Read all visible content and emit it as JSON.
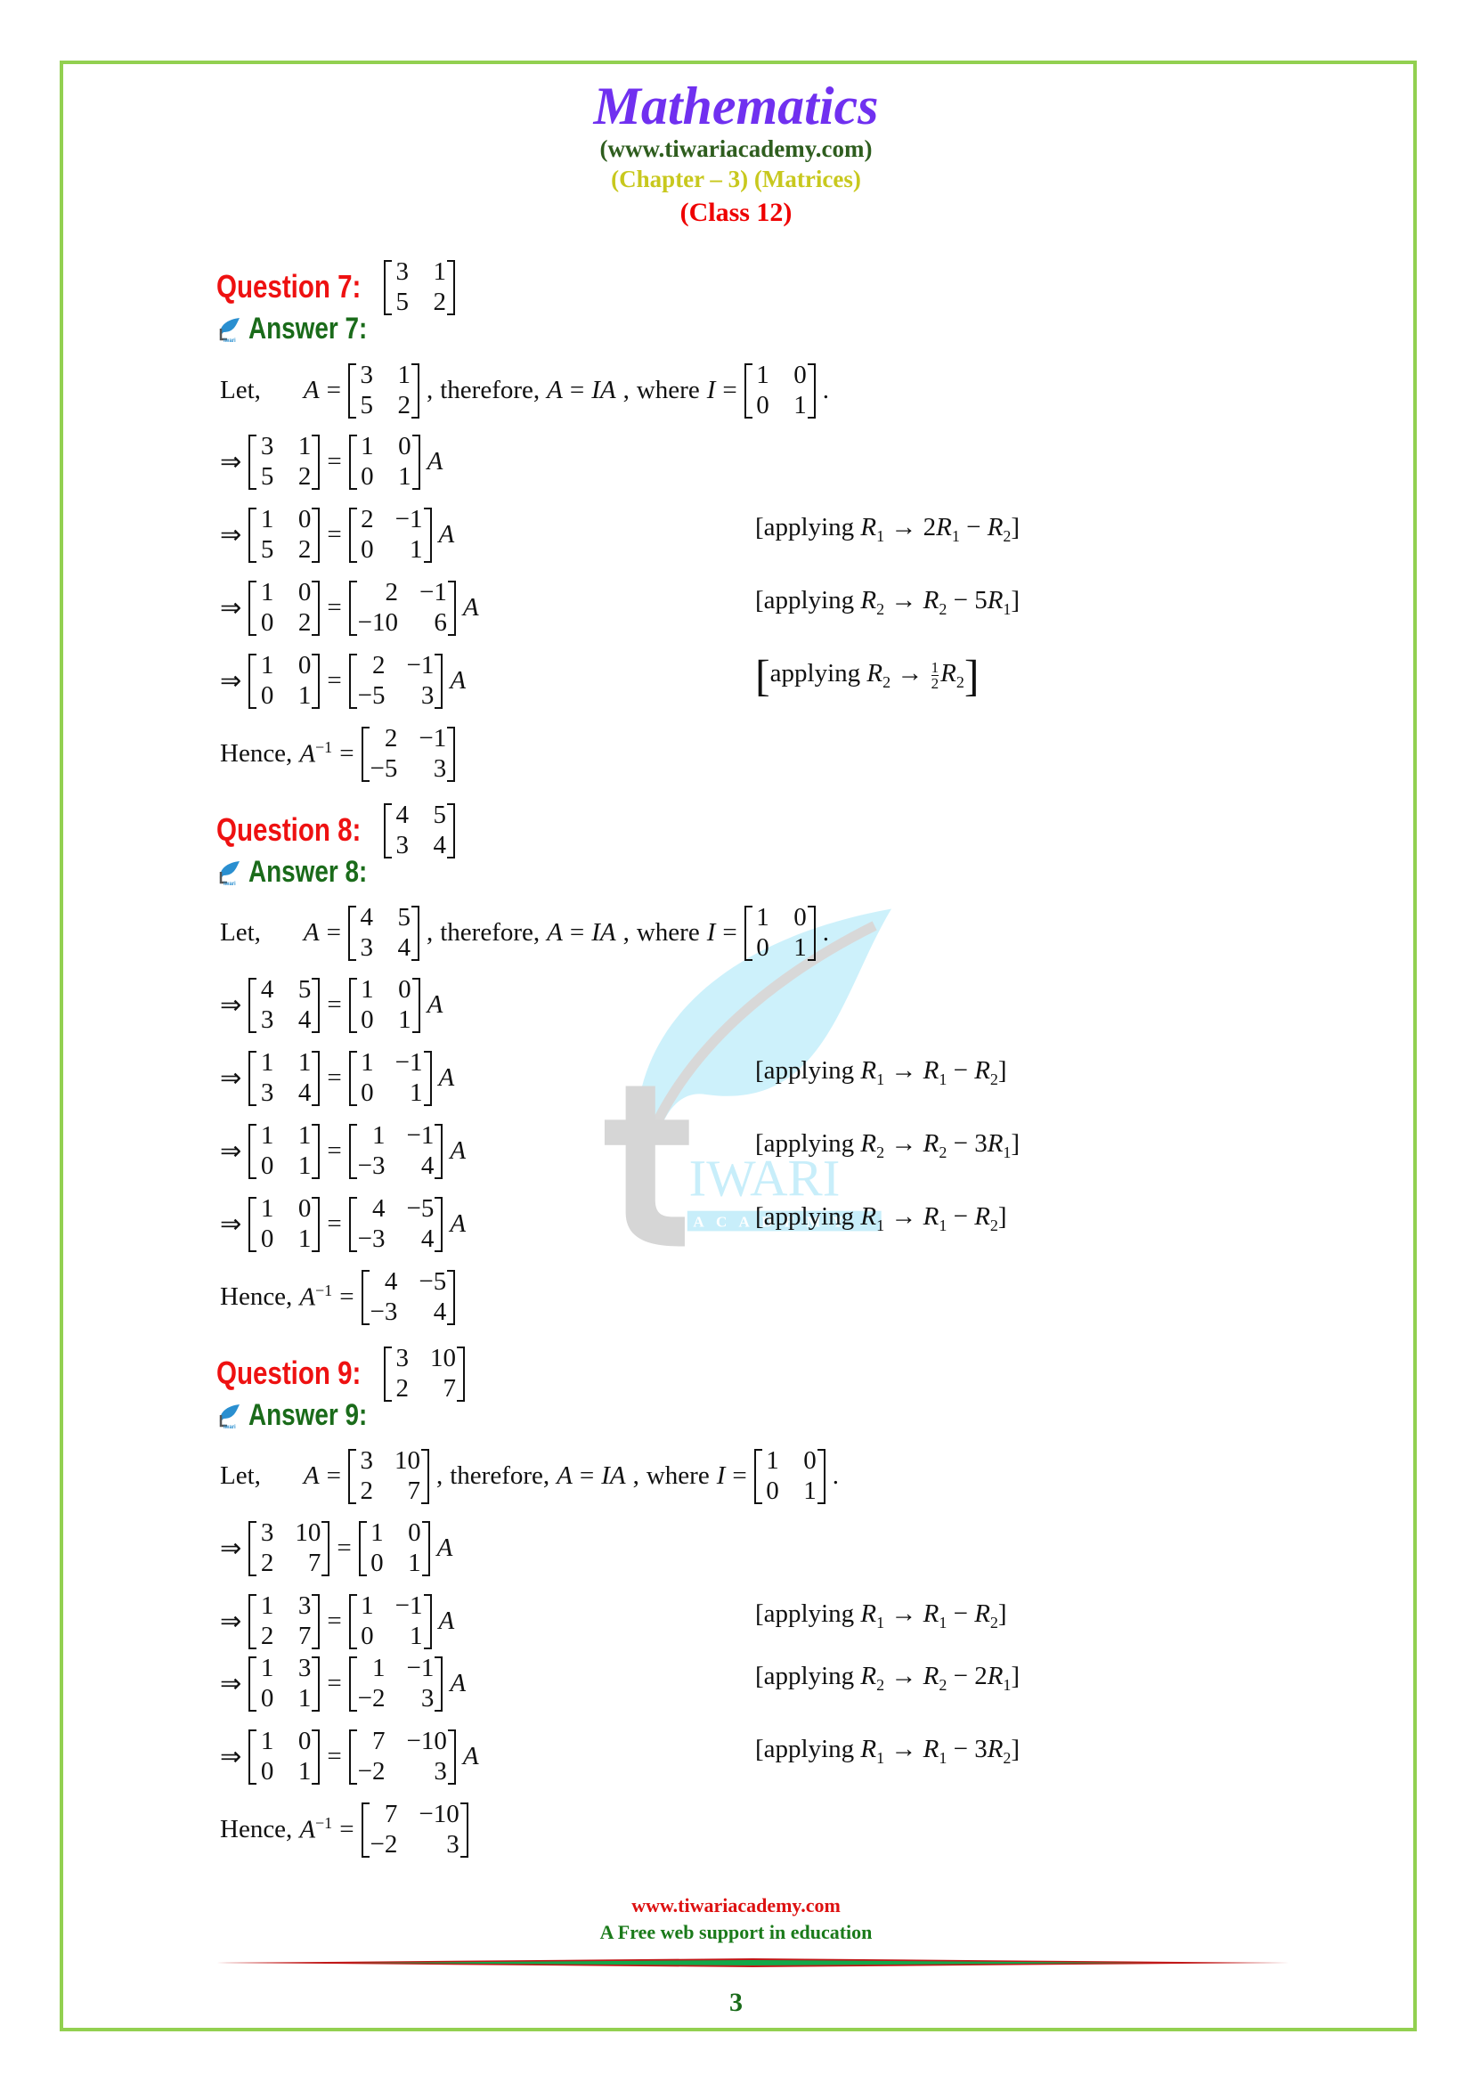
{
  "header": {
    "title": "Mathematics",
    "website": "(www.tiwariacademy.com)",
    "chapter": "(Chapter – 3) (Matrices)",
    "class": "(Class 12)"
  },
  "labels": {
    "let": "Let,",
    "therefore": "therefore,",
    "where": "where",
    "hence": "Hence,",
    "implies": "⇒",
    "applying": "applying",
    "A": "A",
    "I": "I",
    "IA": "IA",
    "Ainv": "A",
    "inv_sup": "−1"
  },
  "questions": [
    {
      "question_label": "Question 7:",
      "answer_label": "Answer 7:",
      "matrix": [
        [
          "3",
          "1"
        ],
        [
          "5",
          "2"
        ]
      ],
      "identity": [
        [
          "1",
          "0"
        ],
        [
          "0",
          "1"
        ]
      ],
      "steps": [
        {
          "lhs": [
            [
              "3",
              "1"
            ],
            [
              "5",
              "2"
            ]
          ],
          "rhs": [
            [
              "1",
              "0"
            ],
            [
              "0",
              "1"
            ]
          ],
          "op": ""
        },
        {
          "lhs": [
            [
              "1",
              "0"
            ],
            [
              "5",
              "2"
            ]
          ],
          "rhs": [
            [
              "2",
              "−1"
            ],
            [
              "0",
              "1"
            ]
          ],
          "op": "R1 → 2R1 − R2"
        },
        {
          "lhs": [
            [
              "1",
              "0"
            ],
            [
              "0",
              "2"
            ]
          ],
          "rhs": [
            [
              "2",
              "−1"
            ],
            [
              "−10",
              "6"
            ]
          ],
          "op": "R2 → R2 − 5R1"
        },
        {
          "lhs": [
            [
              "1",
              "0"
            ],
            [
              "0",
              "1"
            ]
          ],
          "rhs": [
            [
              "2",
              "−1"
            ],
            [
              "−5",
              "3"
            ]
          ],
          "op": "R2 → (1/2)R2"
        }
      ],
      "inverse": [
        [
          "2",
          "−1"
        ],
        [
          "−5",
          "3"
        ]
      ]
    },
    {
      "question_label": "Question 8:",
      "answer_label": "Answer 8:",
      "matrix": [
        [
          "4",
          "5"
        ],
        [
          "3",
          "4"
        ]
      ],
      "identity": [
        [
          "1",
          "0"
        ],
        [
          "0",
          "1"
        ]
      ],
      "steps": [
        {
          "lhs": [
            [
              "4",
              "5"
            ],
            [
              "3",
              "4"
            ]
          ],
          "rhs": [
            [
              "1",
              "0"
            ],
            [
              "0",
              "1"
            ]
          ],
          "op": ""
        },
        {
          "lhs": [
            [
              "1",
              "1"
            ],
            [
              "3",
              "4"
            ]
          ],
          "rhs": [
            [
              "1",
              "−1"
            ],
            [
              "0",
              "1"
            ]
          ],
          "op": "R1 → R1 − R2"
        },
        {
          "lhs": [
            [
              "1",
              "1"
            ],
            [
              "0",
              "1"
            ]
          ],
          "rhs": [
            [
              "1",
              "−1"
            ],
            [
              "−3",
              "4"
            ]
          ],
          "op": "R2 → R2 − 3R1"
        },
        {
          "lhs": [
            [
              "1",
              "0"
            ],
            [
              "0",
              "1"
            ]
          ],
          "rhs": [
            [
              "4",
              "−5"
            ],
            [
              "−3",
              "4"
            ]
          ],
          "op": "R1 → R1 − R2"
        }
      ],
      "inverse": [
        [
          "4",
          "−5"
        ],
        [
          "−3",
          "4"
        ]
      ]
    },
    {
      "question_label": "Question 9:",
      "answer_label": "Answer 9:",
      "matrix": [
        [
          "3",
          "10"
        ],
        [
          "2",
          "7"
        ]
      ],
      "identity": [
        [
          "1",
          "0"
        ],
        [
          "0",
          "1"
        ]
      ],
      "steps": [
        {
          "lhs": [
            [
              "3",
              "10"
            ],
            [
              "2",
              "7"
            ]
          ],
          "rhs": [
            [
              "1",
              "0"
            ],
            [
              "0",
              "1"
            ]
          ],
          "op": ""
        },
        {
          "lhs": [
            [
              "1",
              "3"
            ],
            [
              "2",
              "7"
            ]
          ],
          "rhs": [
            [
              "1",
              "−1"
            ],
            [
              "0",
              "1"
            ]
          ],
          "op": "R1 → R1 − R2"
        },
        {
          "lhs": [
            [
              "1",
              "3"
            ],
            [
              "0",
              "1"
            ]
          ],
          "rhs": [
            [
              "1",
              "−1"
            ],
            [
              "−2",
              "3"
            ]
          ],
          "op": "R2 → R2 − 2R1"
        },
        {
          "lhs": [
            [
              "1",
              "0"
            ],
            [
              "0",
              "1"
            ]
          ],
          "rhs": [
            [
              "7",
              "−10"
            ],
            [
              "−2",
              "3"
            ]
          ],
          "op": "R1 → R1 − 3R2"
        }
      ],
      "inverse": [
        [
          "7",
          "−10"
        ],
        [
          "−2",
          "3"
        ]
      ]
    }
  ],
  "watermark": {
    "text_main": "IWARI",
    "text_sub": "ACADEMY",
    "icon": "tiwari-leaf-logo"
  },
  "footer": {
    "url": "www.tiwariacademy.com",
    "tagline": "A Free web support in education",
    "page_number": "3"
  },
  "colors": {
    "title": "#7030f0",
    "website": "#2e5d1e",
    "chapter": "#c8c81e",
    "class": "#ee0000",
    "question": "#ee1111",
    "answer": "#1a6b1a",
    "frame": "#92d050"
  }
}
